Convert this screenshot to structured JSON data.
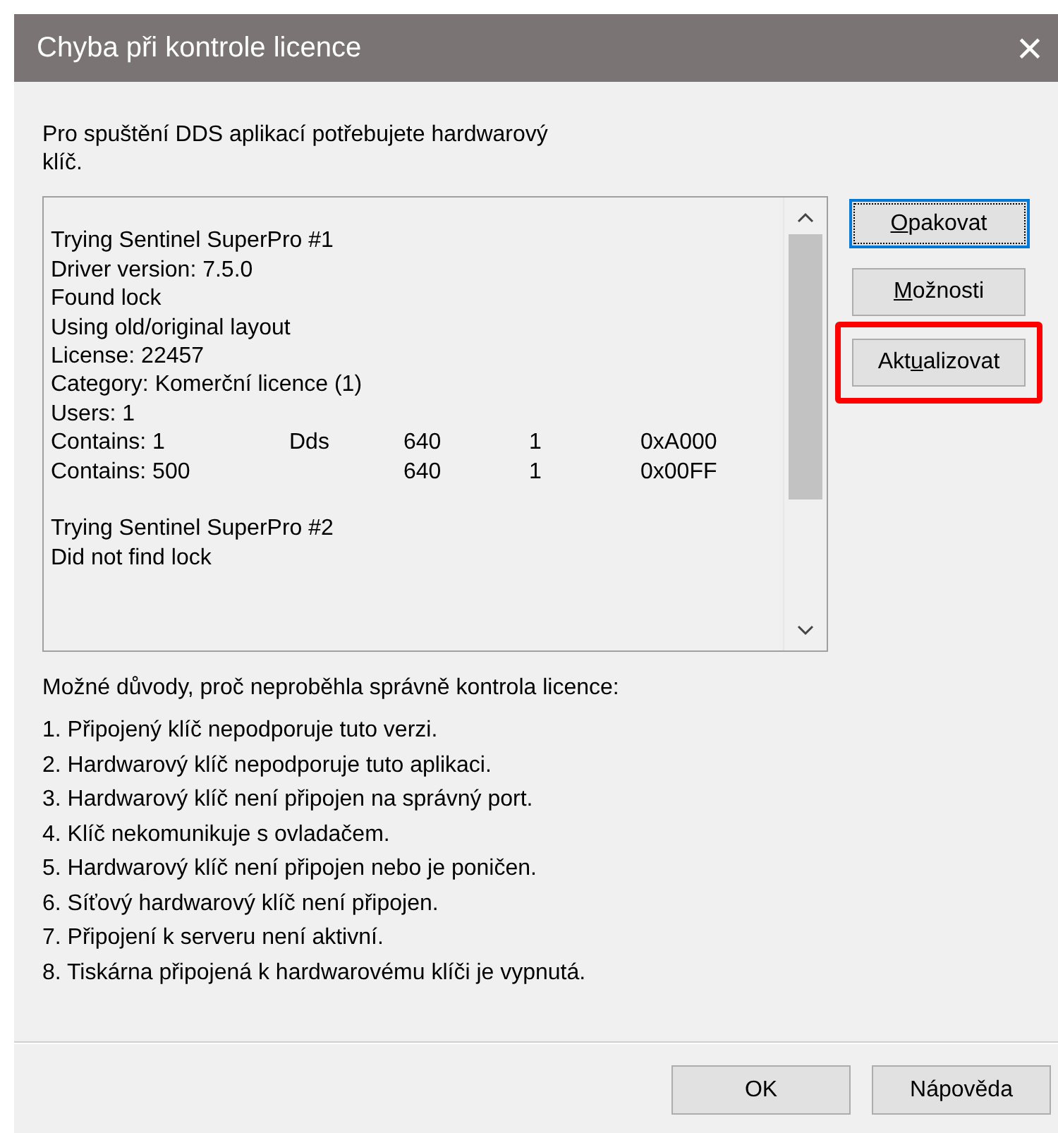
{
  "window": {
    "title": "Chyba při kontrole licence",
    "close": "×"
  },
  "message": "Pro spuštění DDS aplikací potřebujete hardwarový klíč.",
  "log": [
    {
      "kind": "blank"
    },
    {
      "kind": "text",
      "text": "Trying Sentinel SuperPro #1"
    },
    {
      "kind": "text",
      "text": "Driver version: 7.5.0"
    },
    {
      "kind": "text",
      "text": "Found lock"
    },
    {
      "kind": "text",
      "text": "Using old/original layout"
    },
    {
      "kind": "text",
      "text": "License: 22457"
    },
    {
      "kind": "text",
      "text": "Category: Komerční licence (1)"
    },
    {
      "kind": "text",
      "text": "Users: 1"
    },
    {
      "kind": "row",
      "c1": "Contains: 1",
      "c2": "Dds",
      "c3": "640",
      "c4": "1",
      "c5": "0xA000"
    },
    {
      "kind": "row",
      "c1": "Contains: 500",
      "c3": "640",
      "c4": "1",
      "c5": "0x00FF"
    },
    {
      "kind": "blank"
    },
    {
      "kind": "text",
      "text": "Trying Sentinel SuperPro #2"
    },
    {
      "kind": "text",
      "text": "Did not find lock"
    }
  ],
  "side_buttons": [
    {
      "key": "O",
      "after": "pakovat",
      "default": true,
      "highlighted": false
    },
    {
      "key": "M",
      "after": "ožnosti",
      "default": false,
      "highlighted": false
    },
    {
      "before": "Akt",
      "key": "u",
      "after": "alizovat",
      "default": false,
      "highlighted": true
    }
  ],
  "reasons_heading": "Možné důvody, proč neproběhla správně kontrola licence:",
  "reasons": [
    "1. Připojený klíč nepodporuje tuto verzi.",
    "2. Hardwarový klíč nepodporuje tuto aplikaci.",
    "3. Hardwarový klíč není připojen na správný port.",
    "4. Klíč nekomunikuje s ovladačem.",
    "5. Hardwarový klíč není připojen nebo je poničen.",
    "6. Síťový hardwarový klíč není připojen.",
    "7. Připojení k serveru není aktivní.",
    "8. Tiskárna připojená k hardwarovému klíči je vypnutá."
  ],
  "footer_buttons": [
    "OK",
    "Nápověda"
  ]
}
